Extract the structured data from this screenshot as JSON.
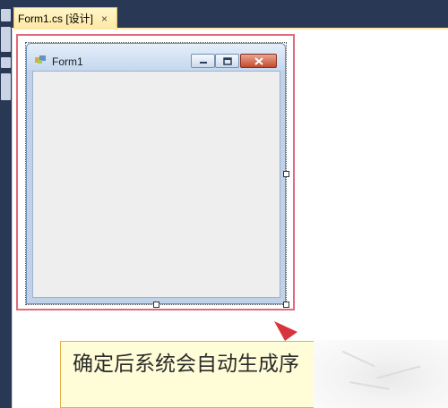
{
  "tab": {
    "label": "Form1.cs [设计]",
    "close": "×"
  },
  "form": {
    "title": "Form1"
  },
  "annotation": {
    "text": "确定后系统会自动生成序"
  },
  "colors": {
    "ide_background": "#293955",
    "tab_active": "#ffe8a6",
    "annotation_border": "#e06b7a",
    "callout_background": "#fffdd8"
  }
}
